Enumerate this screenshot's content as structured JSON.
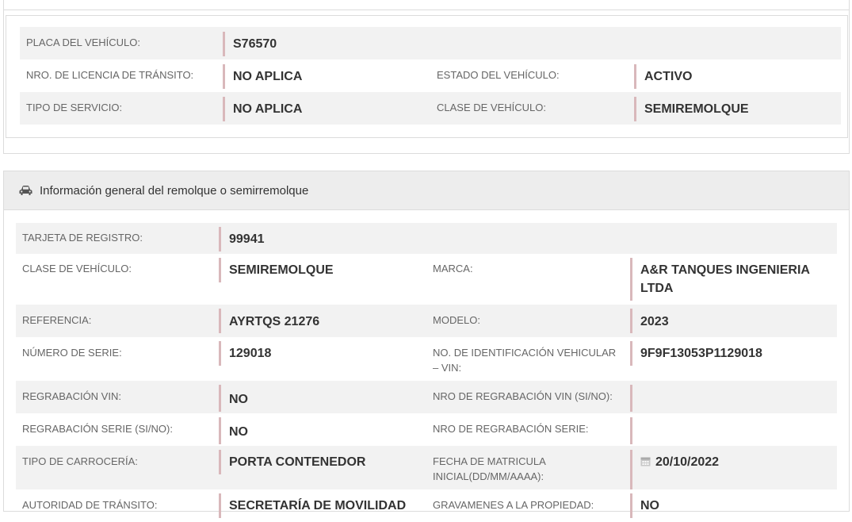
{
  "panel1": {
    "rows": [
      {
        "l1": "PLACA DEL VEHÍCULO:",
        "v1": "S76570"
      },
      {
        "l1": "NRO. DE LICENCIA DE TRÁNSITO:",
        "v1": "NO APLICA",
        "l2": "ESTADO DEL VEHÍCULO:",
        "v2": "ACTIVO"
      },
      {
        "l1": "TIPO DE SERVICIO:",
        "v1": "NO APLICA",
        "l2": "CLASE DE VEHÍCULO:",
        "v2": "SEMIREMOLQUE"
      }
    ]
  },
  "panel2": {
    "header": {
      "title": "Información general del remolque o semirremolque",
      "icon": "car-icon"
    },
    "rows": [
      {
        "l1": "TARJETA DE REGISTRO:",
        "v1": "99941"
      },
      {
        "l1": "CLASE DE VEHÍCULO:",
        "v1": "SEMIREMOLQUE",
        "l2": "MARCA:",
        "v2": "A&R TANQUES INGENIERIA LTDA"
      },
      {
        "l1": "REFERENCIA:",
        "v1": "AYRTQS 21276",
        "l2": "MODELO:",
        "v2": "2023"
      },
      {
        "l1": "NÚMERO DE SERIE:",
        "v1": "129018",
        "l2": "NO. DE IDENTIFICACIÓN VEHICULAR – VIN:",
        "v2": "9F9F13053P1129018"
      },
      {
        "l1": "REGRABACIÓN VIN:",
        "v1": "NO",
        "l2": "NRO DE REGRABACIÓN VIN (SI/NO):",
        "v2": ""
      },
      {
        "l1": "REGRABACIÓN SERIE (SI/NO):",
        "v1": "NO",
        "l2": "NRO DE REGRABACIÓN SERIE:",
        "v2": ""
      },
      {
        "l1": "TIPO DE CARROCERÍA:",
        "v1": "PORTA CONTENEDOR",
        "l2": "FECHA DE MATRICULA INICIAL(DD/MM/AAAA):",
        "v2": "20/10/2022",
        "v2_icon": "calendar-icon"
      },
      {
        "l1": "AUTORIDAD DE TRÁNSITO:",
        "v1": "SECRETARÍA DE MOVILIDAD",
        "l2": "GRAVAMENES A LA PROPIEDAD:",
        "v2": "NO"
      }
    ]
  }
}
